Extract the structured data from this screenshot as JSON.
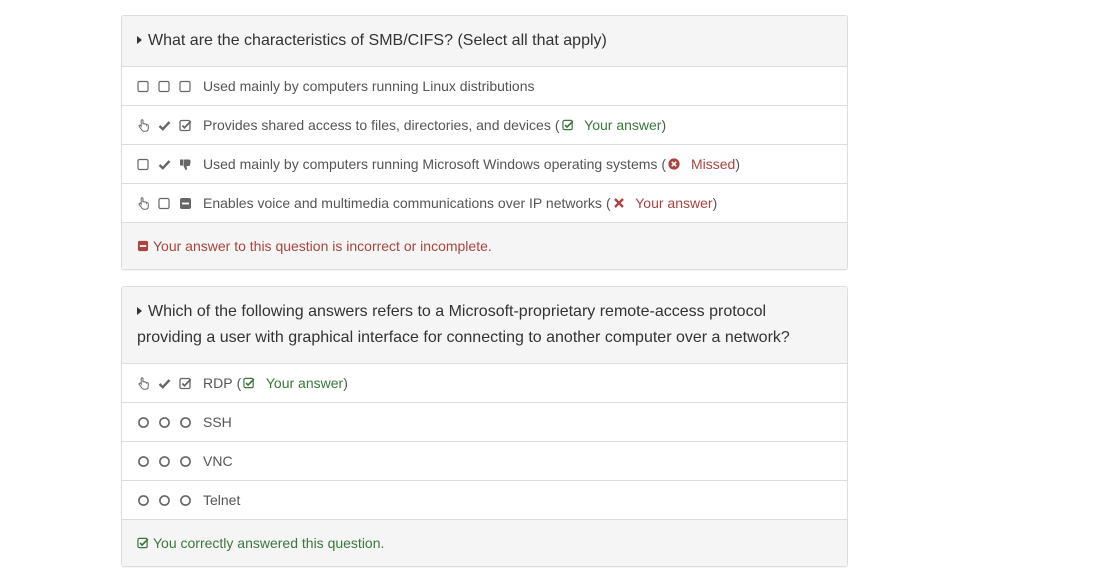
{
  "colors": {
    "correct": "#3c763d",
    "wrong": "#a94442",
    "border": "#dddddd",
    "heading_bg": "#f5f5f5"
  },
  "questions": [
    {
      "title": "What are the characteristics of SMB/CIFS? (Select all that apply)",
      "type": "checkbox",
      "answers": [
        {
          "text": "Used mainly by computers running Linux distributions",
          "icons": [
            "checkbox-empty-icon",
            "checkbox-empty-icon",
            "checkbox-empty-icon"
          ],
          "status": "",
          "status_type": ""
        },
        {
          "text": "Provides shared access to files, directories, and devices",
          "icons": [
            "hand-pointer-icon",
            "checkmark-icon",
            "checkbox-checked-icon"
          ],
          "status": "Your answer",
          "status_type": "correct"
        },
        {
          "text": "Used mainly by computers running Microsoft Windows operating systems",
          "icons": [
            "checkbox-empty-icon",
            "checkmark-icon",
            "thumbs-down-icon"
          ],
          "status": "Missed",
          "status_type": "wrong"
        },
        {
          "text": "Enables voice and multimedia communications over IP networks",
          "icons": [
            "hand-pointer-icon",
            "checkbox-empty-icon",
            "minus-square-icon"
          ],
          "status": "Your answer",
          "status_type": "wrong"
        }
      ],
      "footer": {
        "text": "Your answer to this question is incorrect or incomplete.",
        "type": "wrong",
        "icon": "minus-square-icon"
      }
    },
    {
      "title": "Which of the following answers refers to a Microsoft-proprietary remote-access protocol providing a user with graphical interface for connecting to another computer over a network?",
      "type": "radio",
      "answers": [
        {
          "text": "RDP",
          "icons": [
            "hand-pointer-icon",
            "checkmark-icon",
            "checkbox-checked-icon"
          ],
          "status": "Your answer",
          "status_type": "correct"
        },
        {
          "text": "SSH",
          "icons": [
            "radio-empty-icon",
            "radio-empty-icon",
            "radio-empty-icon"
          ],
          "status": "",
          "status_type": ""
        },
        {
          "text": "VNC",
          "icons": [
            "radio-empty-icon",
            "radio-empty-icon",
            "radio-empty-icon"
          ],
          "status": "",
          "status_type": ""
        },
        {
          "text": "Telnet",
          "icons": [
            "radio-empty-icon",
            "radio-empty-icon",
            "radio-empty-icon"
          ],
          "status": "",
          "status_type": ""
        }
      ],
      "footer": {
        "text": "You correctly answered this question.",
        "type": "correct",
        "icon": "checkbox-checked-icon"
      }
    }
  ]
}
